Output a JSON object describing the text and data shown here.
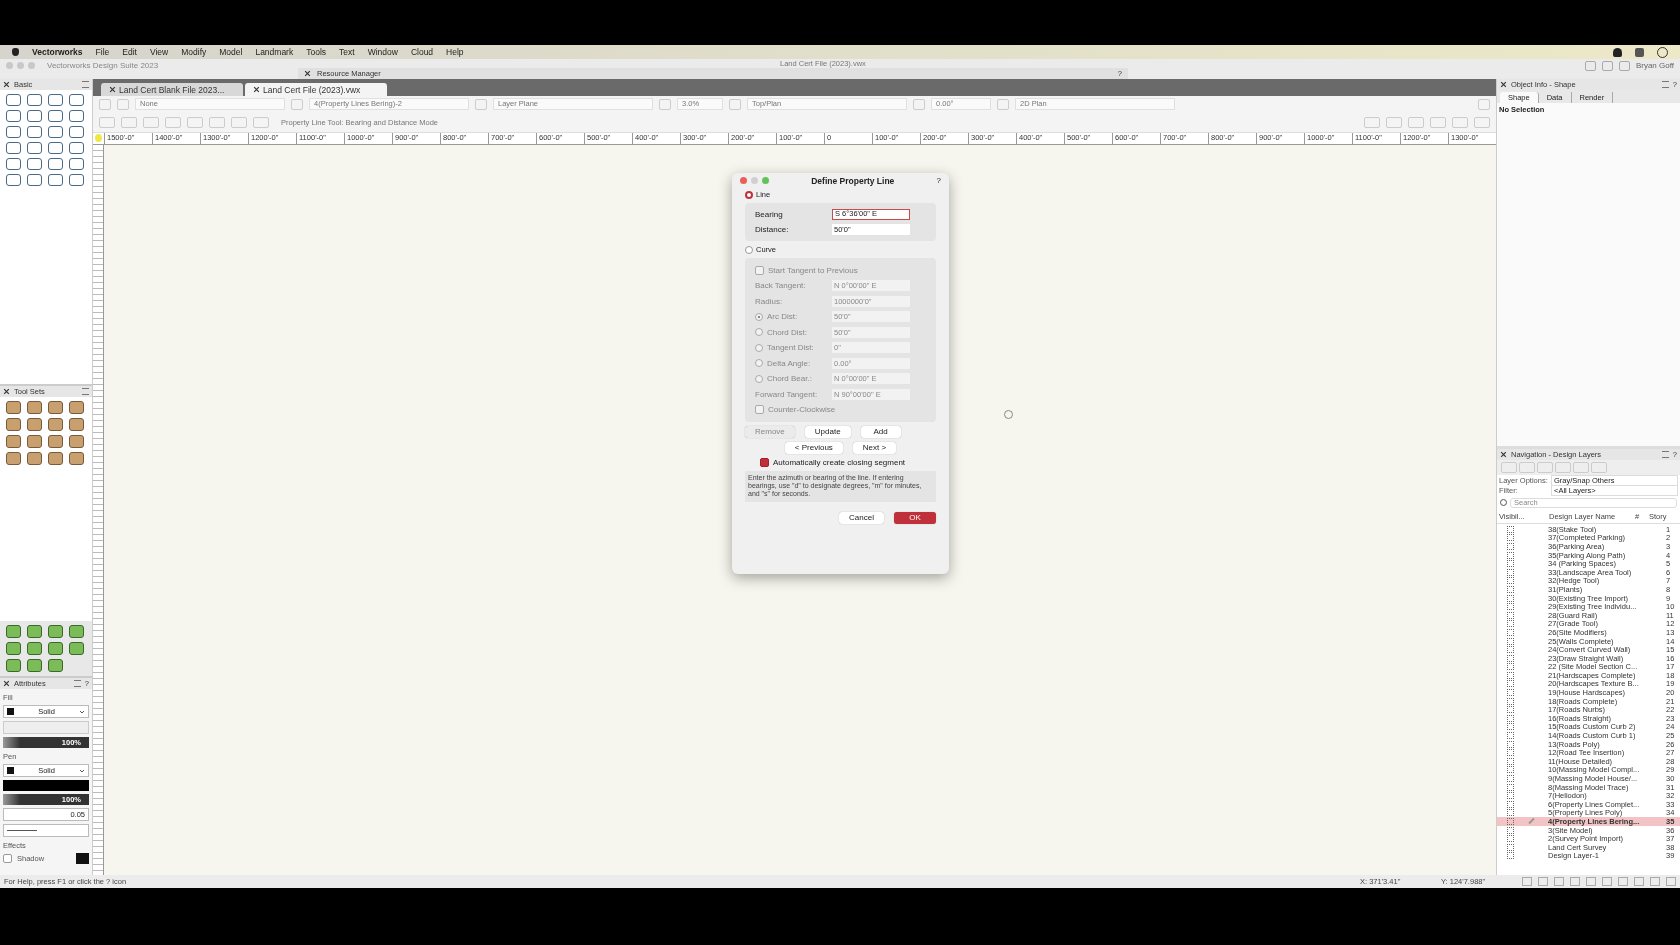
{
  "menu_bar": {
    "app": "Vectorworks",
    "items": [
      "File",
      "Edit",
      "View",
      "Modify",
      "Model",
      "Landmark",
      "Tools",
      "Text",
      "Window",
      "Cloud",
      "Help"
    ]
  },
  "title_bar": {
    "title": "Vectorworks Design Suite 2023",
    "resource_manager": "Resource Manager",
    "help": "?",
    "document": "Land Cert File (2023).vwx",
    "user": "Bryan Goff"
  },
  "document_tabs": [
    {
      "label": "Land Cert Blank File 2023...",
      "selected": false
    },
    {
      "label": "Land Cert File (2023).vwx",
      "selected": true
    }
  ],
  "toolbar": {
    "class": "None",
    "layer": "4(Property Lines Bering)-2",
    "plane": "Layer Plane",
    "zoom": "3.0%",
    "view": "Top/Plan",
    "rotation": "0.00°",
    "render": "2D Plan",
    "mode_hint": "Property Line Tool: Bearing and Distance Mode"
  },
  "ruler": {
    "labels": [
      "1500'-0\"",
      "1400'-0\"",
      "1300'-0\"",
      "1200'-0\"",
      "1100'-0\"",
      "1000'-0\"",
      "900'-0\"",
      "800'-0\"",
      "700'-0\"",
      "600'-0\"",
      "500'-0\"",
      "400'-0\"",
      "300'-0\"",
      "200'-0\"",
      "100'-0\"",
      "0",
      "100'-0\"",
      "200'-0\"",
      "300'-0\"",
      "400'-0\"",
      "500'-0\"",
      "600'-0\"",
      "700'-0\"",
      "800'-0\"",
      "900'-0\"",
      "1000'-0\"",
      "1100'-0\"",
      "1200'-0\"",
      "1300'-0\""
    ]
  },
  "dialog": {
    "title": "Define Property Line",
    "help": "?",
    "modes": [
      {
        "label": "Line",
        "selected": true
      },
      {
        "label": "Curve",
        "selected": false
      }
    ],
    "line_fields": [
      {
        "label": "Bearing",
        "value": "S 6°36'00\" E",
        "focused": true
      },
      {
        "label": "Distance:",
        "value": "50'0\"",
        "focused": false
      }
    ],
    "curve_disabled": true,
    "curve_rows": [
      {
        "kind": "checkbox",
        "label": "Start Tangent to Previous",
        "checked": false
      },
      {
        "kind": "field",
        "label": "Back Tangent:",
        "value": "N 0°00'00\" E"
      },
      {
        "kind": "field",
        "label": "Radius:",
        "value": "1000000'0\""
      },
      {
        "kind": "radio",
        "label": "Arc Dist:",
        "value": "50'0\"",
        "selected": true
      },
      {
        "kind": "radio",
        "label": "Chord Dist:",
        "value": "50'0\"",
        "selected": false
      },
      {
        "kind": "radio",
        "label": "Tangent Dist:",
        "value": "0\"",
        "selected": false
      },
      {
        "kind": "radio",
        "label": "Delta Angle:",
        "value": "0.00°",
        "selected": false
      },
      {
        "kind": "radio",
        "label": "Chord Bear.:",
        "value": "N 0°00'00\" E",
        "selected": false
      },
      {
        "kind": "field",
        "label": "Forward Tangent:",
        "value": "N 90°00'00\" E"
      },
      {
        "kind": "checkbox",
        "label": "Counter-Clockwise",
        "checked": false
      }
    ],
    "edit_buttons": [
      {
        "label": "Remove",
        "disabled": true
      },
      {
        "label": "Update",
        "disabled": false
      },
      {
        "label": "Add",
        "disabled": false
      }
    ],
    "nav_buttons": [
      "< Previous",
      "Next >"
    ],
    "closing_segment": {
      "label": "Automatically create closing segment",
      "checked": true
    },
    "hint": "Enter the azimuth or bearing of the line. If entering bearings, use \"d\" to designate degrees, \"m\" for minutes, and \"s\" for seconds.",
    "cancel": "Cancel",
    "ok": "OK"
  },
  "object_info": {
    "title": "Object Info - Shape",
    "help": "?",
    "tabs": [
      {
        "label": "Shape",
        "selected": true
      },
      {
        "label": "Data",
        "selected": false
      },
      {
        "label": "Render",
        "selected": false
      }
    ],
    "selection": "No Selection"
  },
  "navigation": {
    "title": "Navigation - Design Layers",
    "help": "?",
    "layer_options_label": "Layer Options:",
    "layer_options": "Gray/Snap Others",
    "filter_label": "Filter:",
    "filter": "<All Layers>",
    "search_placeholder": "Search",
    "columns": [
      "Visibil...",
      "Design Layer Name",
      "#",
      "Story"
    ],
    "layers": [
      {
        "name": "38(Stake Tool)",
        "number": "1",
        "selected": false
      },
      {
        "name": "37(Completed Parking)",
        "number": "2",
        "selected": false
      },
      {
        "name": "36(Parking Area)",
        "number": "3",
        "selected": false
      },
      {
        "name": "35(Parking Along Path)",
        "number": "4",
        "selected": false
      },
      {
        "name": "34 (Parking Spaces)",
        "number": "5",
        "selected": false
      },
      {
        "name": "33(Landscape Area Tool)",
        "number": "6",
        "selected": false
      },
      {
        "name": "32(Hedge Tool)",
        "number": "7",
        "selected": false
      },
      {
        "name": "31(Plants)",
        "number": "8",
        "selected": false
      },
      {
        "name": "30(Existing Tree Import)",
        "number": "9",
        "selected": false
      },
      {
        "name": "29(Existing Tree Individu...",
        "number": "10",
        "selected": false
      },
      {
        "name": "28(Guard Rail)",
        "number": "11",
        "selected": false
      },
      {
        "name": "27(Grade Tool)",
        "number": "12",
        "selected": false
      },
      {
        "name": "26(Site Modifiers)",
        "number": "13",
        "selected": false
      },
      {
        "name": "25(Walls Complete)",
        "number": "14",
        "selected": false
      },
      {
        "name": "24(Convert Curved Wall)",
        "number": "15",
        "selected": false
      },
      {
        "name": "23(Draw Straight Wall)",
        "number": "16",
        "selected": false
      },
      {
        "name": "22 (Site Model Section C...",
        "number": "17",
        "selected": false
      },
      {
        "name": "21(Hardscapes Complete)",
        "number": "18",
        "selected": false
      },
      {
        "name": "20(Hardscapes Texture B...",
        "number": "19",
        "selected": false
      },
      {
        "name": "19(House Hardscapes)",
        "number": "20",
        "selected": false
      },
      {
        "name": "18(Roads Complete)",
        "number": "21",
        "selected": false
      },
      {
        "name": "17(Roads Nurbs)",
        "number": "22",
        "selected": false
      },
      {
        "name": "16(Roads Straight)",
        "number": "23",
        "selected": false
      },
      {
        "name": "15(Roads Custom Curb 2)",
        "number": "24",
        "selected": false
      },
      {
        "name": "14(Roads Custom Curb 1)",
        "number": "25",
        "selected": false
      },
      {
        "name": "13(Roads Poly)",
        "number": "26",
        "selected": false
      },
      {
        "name": "12(Road Tee Insertion)",
        "number": "27",
        "selected": false
      },
      {
        "name": "11(House Detailed)",
        "number": "28",
        "selected": false
      },
      {
        "name": "10(Massing Model Compl...",
        "number": "29",
        "selected": false
      },
      {
        "name": "9(Massing Model House/...",
        "number": "30",
        "selected": false
      },
      {
        "name": "8(Massing Model Trace)",
        "number": "31",
        "selected": false
      },
      {
        "name": "7(Heliodon)",
        "number": "32",
        "selected": false
      },
      {
        "name": "6(Property Lines Complet...",
        "number": "33",
        "selected": false
      },
      {
        "name": "5(Property Lines Poly)",
        "number": "34",
        "selected": false
      },
      {
        "name": "4(Property Lines Bering...",
        "number": "35",
        "selected": true
      },
      {
        "name": "3(Site Model)",
        "number": "36",
        "selected": false
      },
      {
        "name": "2(Survey Point Import)",
        "number": "37",
        "selected": false
      },
      {
        "name": "Land Cert Survey",
        "number": "38",
        "selected": false
      },
      {
        "name": "Design Layer-1",
        "number": "39",
        "selected": false
      }
    ]
  },
  "palettes": {
    "basic": "Basic",
    "tool_sets": "Tool Sets"
  },
  "attributes": {
    "title": "Attributes",
    "help": "?",
    "fill_label": "Fill",
    "fill_style": "Solid",
    "fill_opacity": {
      "reading": "100%",
      "level": 1
    },
    "pen_label": "Pen",
    "pen_style": "Solid",
    "pen_opacity": {
      "reading": "100%",
      "level": 1
    },
    "line_weight": "0.05",
    "effects_label": "Effects",
    "shadow_label": "Shadow",
    "shadow": false
  },
  "status_bar": {
    "help": "For Help, press F1 or click the ? icon",
    "x": "X: 371'3.41\"",
    "y": "Y: 124'7.988\""
  }
}
